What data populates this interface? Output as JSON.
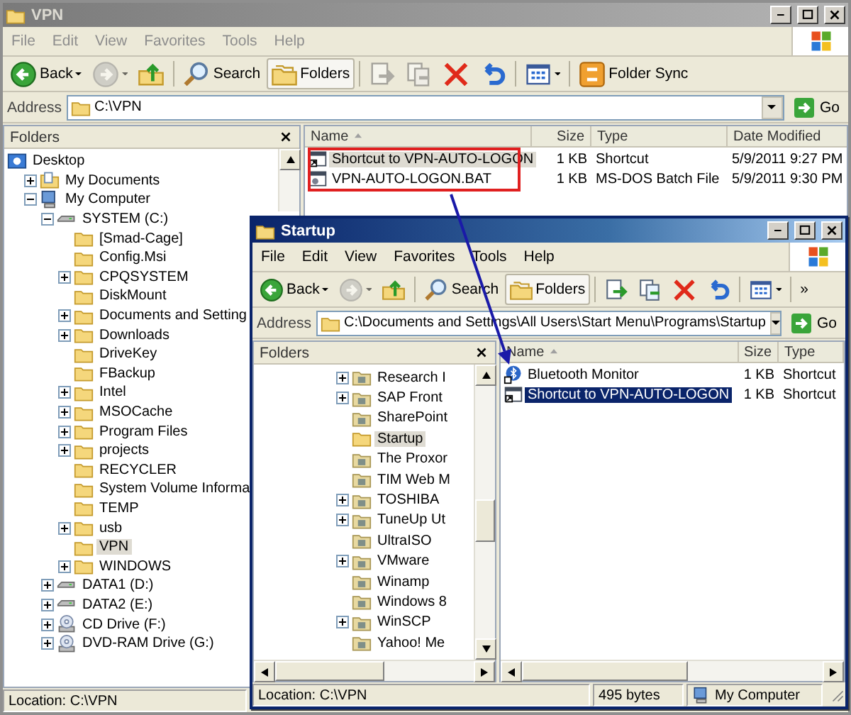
{
  "windows": [
    {
      "title": "VPN",
      "active": false,
      "menu": [
        "File",
        "Edit",
        "View",
        "Favorites",
        "Tools",
        "Help"
      ],
      "toolbar": [
        {
          "kind": "back",
          "label": "Back",
          "pressed": false,
          "disabled": false
        },
        {
          "kind": "forward",
          "pressed": false,
          "disabled": true
        },
        {
          "kind": "up",
          "pressed": false,
          "disabled": false
        },
        {
          "kind": "search",
          "label": "Search",
          "pressed": false,
          "disabled": false
        },
        {
          "kind": "folders",
          "label": "Folders",
          "pressed": true,
          "disabled": false
        },
        {
          "kind": "move",
          "pressed": false,
          "disabled": true
        },
        {
          "kind": "copy",
          "pressed": false,
          "disabled": true
        },
        {
          "kind": "delete",
          "pressed": false,
          "disabled": false
        },
        {
          "kind": "undo",
          "pressed": false,
          "disabled": false
        },
        {
          "kind": "views",
          "pressed": false,
          "disabled": false
        },
        {
          "kind": "sync",
          "label": "Folder Sync",
          "pressed": false,
          "disabled": false
        }
      ],
      "address": {
        "label": "Address",
        "value": "C:\\VPN",
        "go": "Go"
      },
      "folders_pane": {
        "title": "Folders",
        "tree": [
          {
            "label": "Desktop",
            "kind": "desktop",
            "selected": false,
            "children": [
              {
                "label": "My Documents",
                "kind": "documents",
                "expanded": false,
                "selected": false
              },
              {
                "label": "My Computer",
                "kind": "computer",
                "expanded": true,
                "selected": false,
                "children": [
                  {
                    "label": "SYSTEM (C:)",
                    "kind": "drive",
                    "expanded": true,
                    "selected": false,
                    "children": [
                      {
                        "label": "[Smad-Cage]",
                        "kind": "folder",
                        "selected": false
                      },
                      {
                        "label": "Config.Msi",
                        "kind": "folder",
                        "selected": false
                      },
                      {
                        "label": "CPQSYSTEM",
                        "kind": "folder",
                        "expanded": false,
                        "selected": false
                      },
                      {
                        "label": "DiskMount",
                        "kind": "folder",
                        "selected": false
                      },
                      {
                        "label": "Documents and Setting",
                        "kind": "folder",
                        "expanded": false,
                        "selected": false
                      },
                      {
                        "label": "Downloads",
                        "kind": "folder",
                        "expanded": false,
                        "selected": false
                      },
                      {
                        "label": "DriveKey",
                        "kind": "folder",
                        "selected": false
                      },
                      {
                        "label": "FBackup",
                        "kind": "folder",
                        "selected": false
                      },
                      {
                        "label": "Intel",
                        "kind": "folder",
                        "expanded": false,
                        "selected": false
                      },
                      {
                        "label": "MSOCache",
                        "kind": "folder",
                        "expanded": false,
                        "selected": false
                      },
                      {
                        "label": "Program Files",
                        "kind": "folder",
                        "expanded": false,
                        "selected": false
                      },
                      {
                        "label": "projects",
                        "kind": "folder",
                        "expanded": false,
                        "selected": false
                      },
                      {
                        "label": "RECYCLER",
                        "kind": "folder",
                        "selected": false
                      },
                      {
                        "label": "System Volume Informa",
                        "kind": "folder",
                        "selected": false
                      },
                      {
                        "label": "TEMP",
                        "kind": "folder",
                        "selected": false
                      },
                      {
                        "label": "usb",
                        "kind": "folder",
                        "expanded": false,
                        "selected": false
                      },
                      {
                        "label": "VPN",
                        "kind": "folder",
                        "selected": true
                      },
                      {
                        "label": "WINDOWS",
                        "kind": "folder",
                        "expanded": false,
                        "selected": false
                      }
                    ]
                  },
                  {
                    "label": "DATA1 (D:)",
                    "kind": "drive",
                    "expanded": false,
                    "selected": false
                  },
                  {
                    "label": "DATA2 (E:)",
                    "kind": "drive",
                    "expanded": false,
                    "selected": false
                  },
                  {
                    "label": "CD Drive (F:)",
                    "kind": "cd",
                    "expanded": false,
                    "selected": false
                  },
                  {
                    "label": "DVD-RAM Drive (G:)",
                    "kind": "cd",
                    "expanded": false,
                    "selected": false
                  }
                ]
              }
            ]
          }
        ]
      },
      "list": {
        "columns": [
          {
            "label": "Name",
            "sorted": true
          },
          {
            "label": "Size",
            "sorted": false
          },
          {
            "label": "Type",
            "sorted": false
          },
          {
            "label": "Date Modified",
            "sorted": false
          }
        ],
        "rows": [
          {
            "kind": "shortcut",
            "selected": true,
            "cells": [
              "Shortcut to VPN-AUTO-LOGON",
              "1 KB",
              "Shortcut",
              "5/9/2011 9:27 PM"
            ]
          },
          {
            "kind": "batch",
            "selected": false,
            "cells": [
              "VPN-AUTO-LOGON.BAT",
              "1 KB",
              "MS-DOS Batch File",
              "5/9/2011 9:30 PM"
            ]
          }
        ]
      },
      "status": [
        {
          "text": "Location: C:\\VPN"
        }
      ]
    },
    {
      "title": "Startup",
      "active": true,
      "menu": [
        "File",
        "Edit",
        "View",
        "Favorites",
        "Tools",
        "Help"
      ],
      "toolbar": [
        {
          "kind": "back",
          "label": "Back",
          "pressed": false,
          "disabled": false
        },
        {
          "kind": "forward",
          "pressed": false,
          "disabled": true
        },
        {
          "kind": "up",
          "pressed": false,
          "disabled": false
        },
        {
          "kind": "search",
          "label": "Search",
          "pressed": false,
          "disabled": false
        },
        {
          "kind": "folders",
          "label": "Folders",
          "pressed": true,
          "disabled": false
        },
        {
          "kind": "move",
          "pressed": false,
          "disabled": false
        },
        {
          "kind": "copy",
          "pressed": false,
          "disabled": false
        },
        {
          "kind": "delete",
          "pressed": false,
          "disabled": false
        },
        {
          "kind": "undo",
          "pressed": false,
          "disabled": false
        },
        {
          "kind": "views",
          "pressed": false,
          "disabled": false
        },
        {
          "kind": "chevron",
          "label": "»",
          "pressed": false,
          "disabled": false
        }
      ],
      "address": {
        "label": "Address",
        "value": "C:\\Documents and Settings\\All Users\\Start Menu\\Programs\\Startup",
        "go": "Go"
      },
      "folders_pane": {
        "title": "Folders",
        "tree": [
          {
            "label": "Research I",
            "kind": "progfolder",
            "expanded": false,
            "selected": false
          },
          {
            "label": "SAP Front",
            "kind": "progfolder",
            "expanded": false,
            "selected": false
          },
          {
            "label": "SharePoint",
            "kind": "progfolder",
            "selected": false
          },
          {
            "label": "Startup",
            "kind": "folder",
            "selected": true
          },
          {
            "label": "The Proxor",
            "kind": "progfolder",
            "selected": false
          },
          {
            "label": "TIM Web M",
            "kind": "progfolder",
            "selected": false
          },
          {
            "label": "TOSHIBA",
            "kind": "progfolder",
            "expanded": false,
            "selected": false
          },
          {
            "label": "TuneUp Ut",
            "kind": "progfolder",
            "expanded": false,
            "selected": false
          },
          {
            "label": "UltraISO",
            "kind": "progfolder",
            "selected": false
          },
          {
            "label": "VMware",
            "kind": "progfolder",
            "expanded": false,
            "selected": false
          },
          {
            "label": "Winamp",
            "kind": "progfolder",
            "selected": false
          },
          {
            "label": "Windows 8",
            "kind": "progfolder",
            "selected": false
          },
          {
            "label": "WinSCP",
            "kind": "progfolder",
            "expanded": false,
            "selected": false
          },
          {
            "label": "Yahoo! Me",
            "kind": "progfolder",
            "selected": false
          }
        ]
      },
      "list": {
        "columns": [
          {
            "label": "Name",
            "sorted": true
          },
          {
            "label": "Size",
            "sorted": false
          },
          {
            "label": "Type",
            "sorted": false
          }
        ],
        "rows": [
          {
            "kind": "bluetooth",
            "selected": false,
            "cells": [
              "Bluetooth Monitor",
              "1 KB",
              "Shortcut"
            ]
          },
          {
            "kind": "shortcut",
            "selected": true,
            "cells": [
              "Shortcut to VPN-AUTO-LOGON",
              "1 KB",
              "Shortcut"
            ]
          }
        ]
      },
      "status": [
        {
          "text": "Location: C:\\VPN"
        },
        {
          "text": "495 bytes"
        },
        {
          "text": "My Computer",
          "kind": "computer"
        }
      ]
    }
  ]
}
